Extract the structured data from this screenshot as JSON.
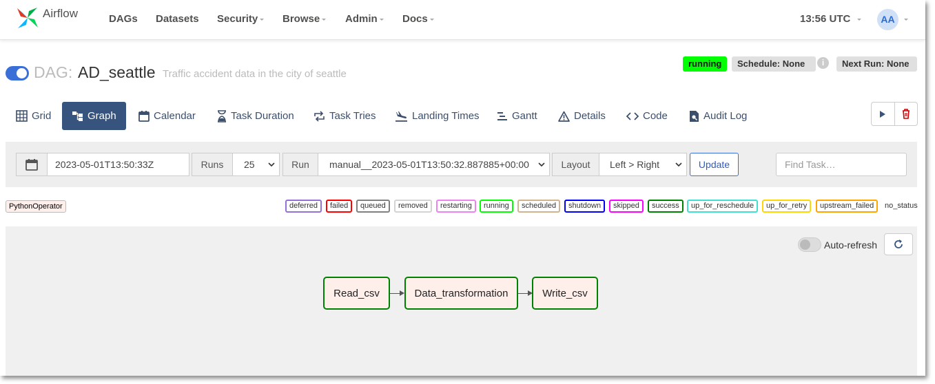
{
  "navbar": {
    "brand": "Airflow",
    "items": [
      {
        "label": "DAGs",
        "dropdown": false
      },
      {
        "label": "Datasets",
        "dropdown": false
      },
      {
        "label": "Security",
        "dropdown": true
      },
      {
        "label": "Browse",
        "dropdown": true
      },
      {
        "label": "Admin",
        "dropdown": true
      },
      {
        "label": "Docs",
        "dropdown": true
      }
    ],
    "time": "13:56 UTC",
    "avatar": "AA"
  },
  "dag": {
    "prefix": "DAG:",
    "name": "AD_seattle",
    "description": "Traffic accident data in the city of seattle",
    "paused": false,
    "status_badge": "running",
    "schedule_badge": "Schedule: None",
    "next_run_badge": "Next Run: None",
    "info_icon": "i"
  },
  "tabs": [
    {
      "label": "Grid",
      "icon": "grid-icon"
    },
    {
      "label": "Graph",
      "icon": "graph-icon",
      "active": true
    },
    {
      "label": "Calendar",
      "icon": "calendar-icon"
    },
    {
      "label": "Task Duration",
      "icon": "hourglass-icon"
    },
    {
      "label": "Task Tries",
      "icon": "retry-icon"
    },
    {
      "label": "Landing Times",
      "icon": "landing-icon"
    },
    {
      "label": "Gantt",
      "icon": "gantt-icon"
    },
    {
      "label": "Details",
      "icon": "warning-icon"
    },
    {
      "label": "Code",
      "icon": "code-icon"
    },
    {
      "label": "Audit Log",
      "icon": "audit-icon"
    }
  ],
  "actions": {
    "trigger": "play-icon",
    "delete": "trash-icon"
  },
  "filters": {
    "base_date": "2023-05-01T13:50:33Z",
    "runs_label": "Runs",
    "runs_value": "25",
    "run_label": "Run",
    "run_value": "manual__2023-05-01T13:50:32.887885+00:00",
    "layout_label": "Layout",
    "layout_value": "Left > Right",
    "update_label": "Update",
    "find_placeholder": "Find Task…"
  },
  "legend": {
    "operator": "PythonOperator",
    "states": [
      {
        "label": "deferred",
        "color": "#9370db"
      },
      {
        "label": "failed",
        "color": "#ff0000"
      },
      {
        "label": "queued",
        "color": "#808080"
      },
      {
        "label": "removed",
        "color": "#d3d3d3"
      },
      {
        "label": "restarting",
        "color": "#ee82ee"
      },
      {
        "label": "running",
        "color": "#00ff00"
      },
      {
        "label": "scheduled",
        "color": "#d2b48c"
      },
      {
        "label": "shutdown",
        "color": "#0000ff"
      },
      {
        "label": "skipped",
        "color": "#ff00ff"
      },
      {
        "label": "success",
        "color": "#008000"
      },
      {
        "label": "up_for_reschedule",
        "color": "#40e0d0"
      },
      {
        "label": "up_for_retry",
        "color": "#ffd700"
      },
      {
        "label": "upstream_failed",
        "color": "#ffa500"
      },
      {
        "label": "no_status",
        "color": "transparent"
      }
    ]
  },
  "graph": {
    "autorefresh_label": "Auto-refresh",
    "autorefresh_on": false,
    "nodes": [
      {
        "label": "Read_csv",
        "state": "success"
      },
      {
        "label": "Data_transformation",
        "state": "success"
      },
      {
        "label": "Write_csv",
        "state": "success"
      }
    ]
  }
}
